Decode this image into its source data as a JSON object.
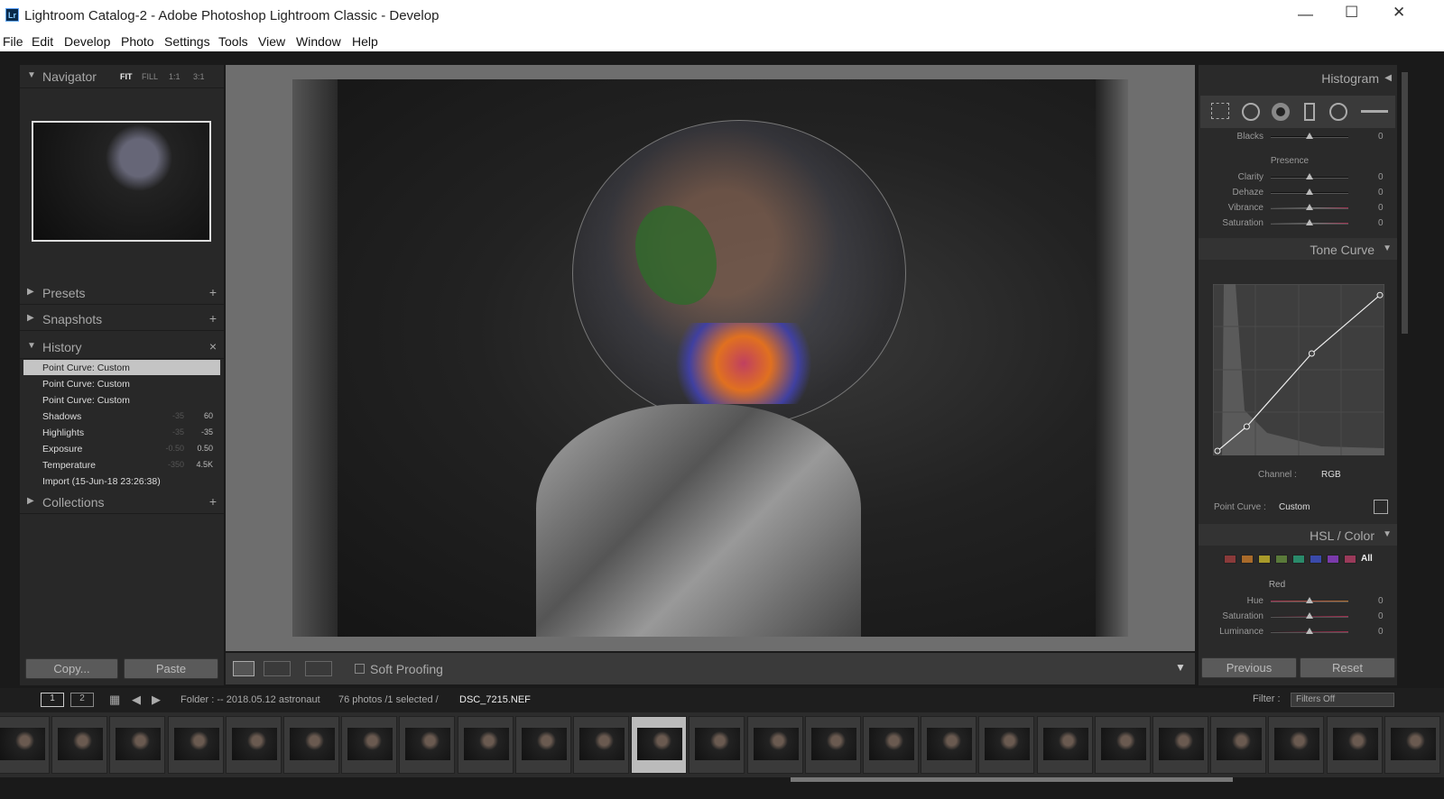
{
  "window": {
    "title": "Lightroom Catalog-2 - Adobe Photoshop Lightroom Classic - Develop",
    "logo": "Lr"
  },
  "menu": [
    "File",
    "Edit",
    "Develop",
    "Photo",
    "Settings",
    "Tools",
    "View",
    "Window",
    "Help"
  ],
  "left": {
    "navigator": {
      "title": "Navigator",
      "options": [
        "FIT",
        "FILL",
        "1:1",
        "3:1"
      ]
    },
    "presets": "Presets",
    "snapshots": "Snapshots",
    "history_title": "History",
    "collections": "Collections",
    "history": [
      {
        "name": "Point Curve: Custom",
        "old": "",
        "new": ""
      },
      {
        "name": "Point Curve: Custom",
        "old": "",
        "new": ""
      },
      {
        "name": "Point Curve: Custom",
        "old": "",
        "new": ""
      },
      {
        "name": "Shadows",
        "old": "-35",
        "new": "60"
      },
      {
        "name": "Highlights",
        "old": "-35",
        "new": "-35"
      },
      {
        "name": "Exposure",
        "old": "-0.50",
        "new": "0.50"
      },
      {
        "name": "Temperature",
        "old": "-350",
        "new": "4.5K"
      },
      {
        "name": "Import (15-Jun-18 23:26:38)",
        "old": "",
        "new": ""
      }
    ],
    "copy": "Copy...",
    "paste": "Paste"
  },
  "toolbar": {
    "soft_proofing": "Soft Proofing"
  },
  "right": {
    "histogram": "Histogram",
    "blacks": {
      "label": "Blacks",
      "value": "0"
    },
    "presence": "Presence",
    "sliders": [
      {
        "label": "Clarity",
        "value": "0"
      },
      {
        "label": "Dehaze",
        "value": "0"
      },
      {
        "label": "Vibrance",
        "value": "0"
      },
      {
        "label": "Saturation",
        "value": "0"
      }
    ],
    "tone_curve": "Tone Curve",
    "channel_label": "Channel :",
    "channel_value": "RGB",
    "point_curve_label": "Point Curve :",
    "point_curve_value": "Custom",
    "curve_points": [
      [
        0,
        0
      ],
      [
        18,
        15
      ],
      [
        58,
        60
      ],
      [
        100,
        96
      ]
    ],
    "hsl": "HSL / Color",
    "hsl_all": "All",
    "swatches": [
      "#8a3a3a",
      "#a86a2a",
      "#a89a2a",
      "#5a7a3a",
      "#2a8a6a",
      "#3a4aaa",
      "#7a3aaa",
      "#9a3a5a"
    ],
    "hsl_color": "Red",
    "hsl_sliders": [
      {
        "label": "Hue",
        "value": "0"
      },
      {
        "label": "Saturation",
        "value": "0"
      },
      {
        "label": "Luminance",
        "value": "0"
      }
    ],
    "previous": "Previous",
    "reset": "Reset"
  },
  "filmstrip": {
    "page1": "1",
    "page2": "2",
    "folder": "Folder : -- 2018.05.12 astronaut",
    "count": "76 photos /1 selected /",
    "file": "DSC_7215.NEF",
    "filter_label": "Filter :",
    "filter_value": "Filters Off"
  }
}
